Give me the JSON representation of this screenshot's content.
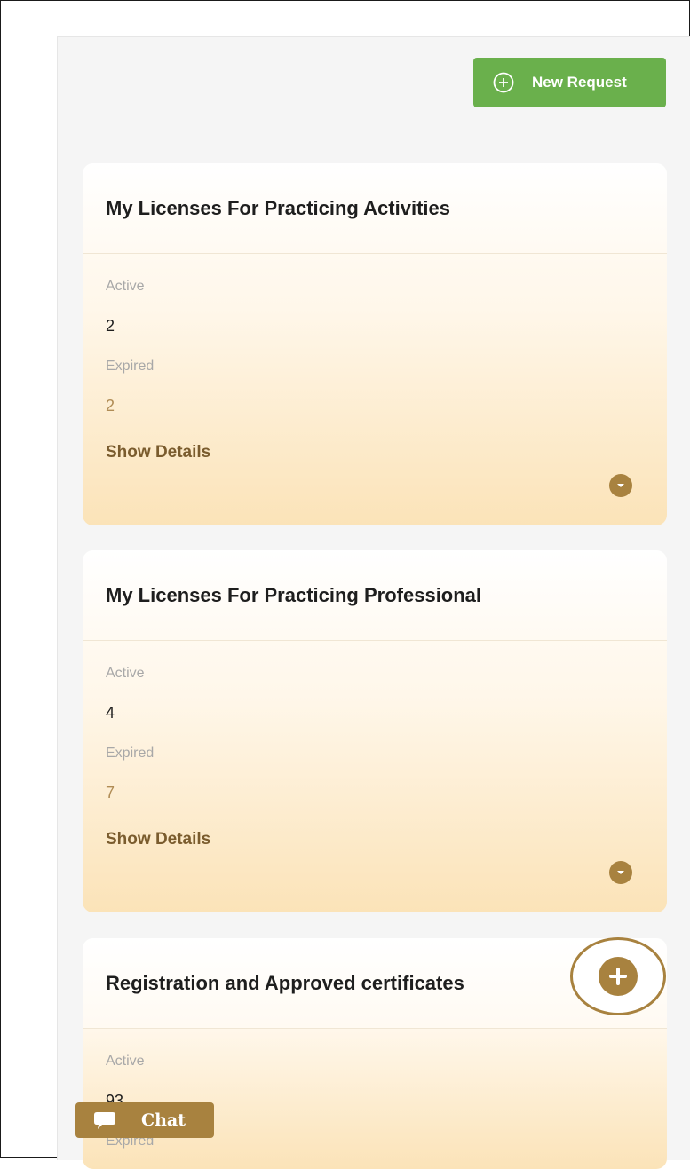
{
  "toolbar": {
    "new_request_label": "New Request"
  },
  "cards": [
    {
      "title": "My Licenses For Practicing Activities",
      "active_label": "Active",
      "active_value": "2",
      "expired_label": "Expired",
      "expired_value": "2",
      "details_label": "Show Details"
    },
    {
      "title": "My Licenses For Practicing Professional",
      "active_label": "Active",
      "active_value": "4",
      "expired_label": "Expired",
      "expired_value": "7",
      "details_label": "Show Details"
    },
    {
      "title": "Registration and Approved certificates",
      "active_label": "Active",
      "active_value": "93",
      "expired_label": "Expired"
    }
  ],
  "chat": {
    "label": "Chat"
  },
  "icons": {
    "new_request": "plus-circle-icon",
    "toggle": "chevron-down-icon",
    "fab": "plus-icon",
    "chat": "chat-bubble-icon"
  },
  "colors": {
    "primary_green": "#6ab04c",
    "accent_gold": "#a8823f",
    "expired_value": "#b08c55",
    "details_text": "#7a5c2e"
  }
}
